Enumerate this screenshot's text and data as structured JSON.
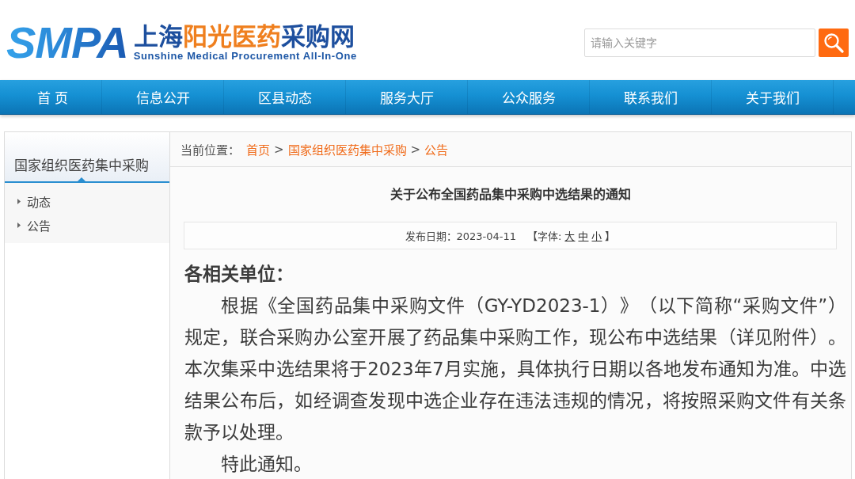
{
  "header": {
    "logo": {
      "acronym": "SMPA",
      "name_parts": [
        {
          "text": "上海",
          "color": "#1d4f9e"
        },
        {
          "text": "阳光医药",
          "color": "#ef7f1e"
        },
        {
          "text": "采购网",
          "color": "#1d4f9e"
        }
      ],
      "subtitle": "Sunshine Medical Procurement All-In-One"
    },
    "search": {
      "placeholder": "请输入关键字"
    }
  },
  "nav": {
    "items": [
      "首 页",
      "信息公开",
      "区县动态",
      "服务大厅",
      "公众服务",
      "联系我们",
      "关于我们"
    ]
  },
  "sidebar": {
    "heading": "国家组织医药集中采购",
    "items": [
      "动态",
      "公告"
    ]
  },
  "breadcrumb": {
    "label": "当前位置：",
    "items": [
      {
        "kind": "link",
        "text": "首页"
      },
      {
        "kind": "separator",
        "text": ">"
      },
      {
        "kind": "link",
        "text": "国家组织医药集中采购"
      },
      {
        "kind": "separator",
        "text": ">"
      },
      {
        "kind": "link",
        "text": "公告"
      }
    ]
  },
  "article": {
    "title": "关于公布全国药品集中采购中选结果的通知",
    "meta": {
      "date": "发布日期：2023-04-11",
      "font_label": "【字体:",
      "font_sizes": [
        "大",
        "中",
        "小"
      ],
      "font_close": "】"
    },
    "salutation": "各相关单位：",
    "paragraphs": [
      "根据《全国药品集中采购文件（GY-YD2023-1）》（以下简称“采购文件”）规定，联合采购办公室开展了药品集中采购工作，现公布中选结果（详见附件）。本次集采中选结果将于2023年7月实施，具体执行日期以各地发布通知为准。中选结果公布后，如经调查发现中选企业存在违法违规的情况，将按照采购文件有关条款予以处理。",
      "特此通知。"
    ]
  }
}
